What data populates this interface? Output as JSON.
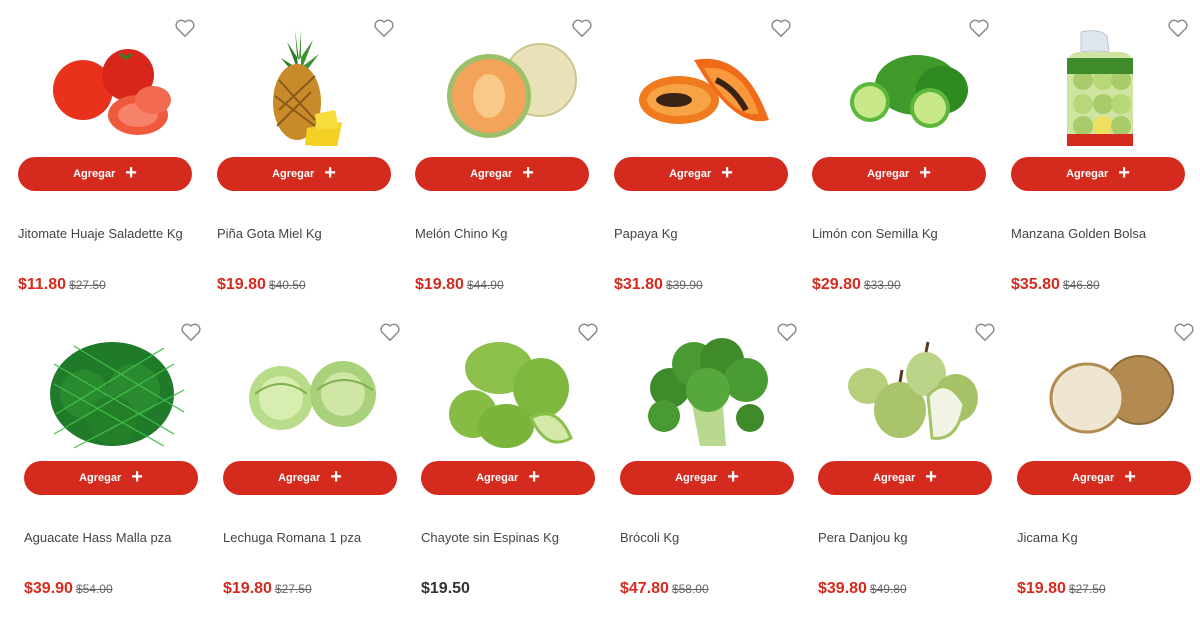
{
  "colors": {
    "accent": "#d52b1e",
    "text": "#444444",
    "old_price": "#666666"
  },
  "add_label": "Agregar",
  "add_icon": "plus-icon",
  "wishlist_icon": "heart-icon",
  "products": [
    {
      "name": "Jitomate Huaje Saladette Kg",
      "price": "$11.80",
      "old_price": "$27.50"
    },
    {
      "name": "Piña Gota Miel Kg",
      "price": "$19.80",
      "old_price": "$40.50"
    },
    {
      "name": "Melón Chino Kg",
      "price": "$19.80",
      "old_price": "$44.90"
    },
    {
      "name": "Papaya Kg",
      "price": "$31.80",
      "old_price": "$39.90"
    },
    {
      "name": "Limón con Semilla Kg",
      "price": "$29.80",
      "old_price": "$33.90"
    },
    {
      "name": "Manzana Golden Bolsa",
      "price": "$35.80",
      "old_price": "$46.80"
    },
    {
      "name": "Aguacate Hass Malla pza",
      "price": "$39.90",
      "old_price": "$54.00"
    },
    {
      "name": "Lechuga Romana 1 pza",
      "price": "$19.80",
      "old_price": "$27.50"
    },
    {
      "name": "Chayote sin Espinas Kg",
      "price": "$19.50",
      "old_price": ""
    },
    {
      "name": "Brócoli Kg",
      "price": "$47.80",
      "old_price": "$58.00"
    },
    {
      "name": "Pera Danjou kg",
      "price": "$39.80",
      "old_price": "$49.80"
    },
    {
      "name": "Jicama Kg",
      "price": "$19.80",
      "old_price": "$27.50"
    }
  ]
}
